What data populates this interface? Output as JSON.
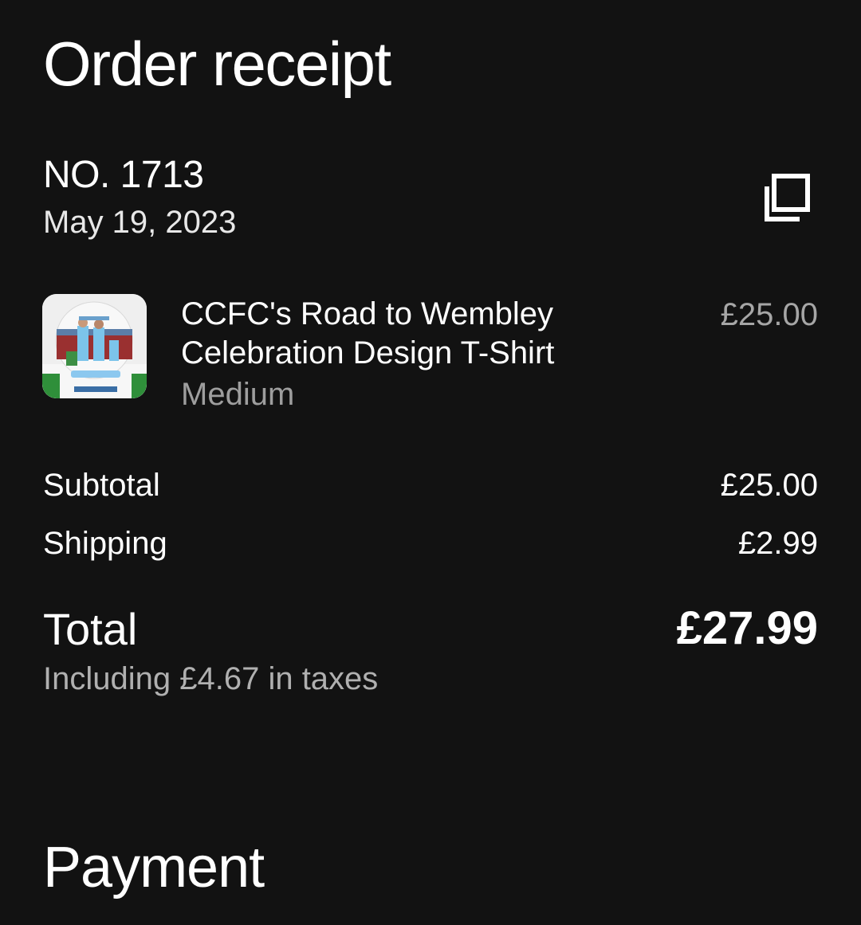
{
  "header": {
    "title": "Order receipt"
  },
  "order": {
    "number": "NO. 1713",
    "date": "May 19, 2023"
  },
  "item": {
    "name": "CCFC's Road to Wembley Celebration Design T-Shirt",
    "variant": "Medium",
    "price": "£25.00",
    "thumbnail_icon": "tshirt-product-image"
  },
  "summary": {
    "subtotal_label": "Subtotal",
    "subtotal_value": "£25.00",
    "shipping_label": "Shipping",
    "shipping_value": "£2.99",
    "total_label": "Total",
    "total_value": "£27.99",
    "tax_note": "Including £4.67 in taxes"
  },
  "payment": {
    "title": "Payment"
  },
  "colors": {
    "background": "#121212",
    "text_primary": "#ffffff",
    "text_secondary": "#9e9e9e"
  },
  "icons": {
    "copy": "copy-icon"
  }
}
